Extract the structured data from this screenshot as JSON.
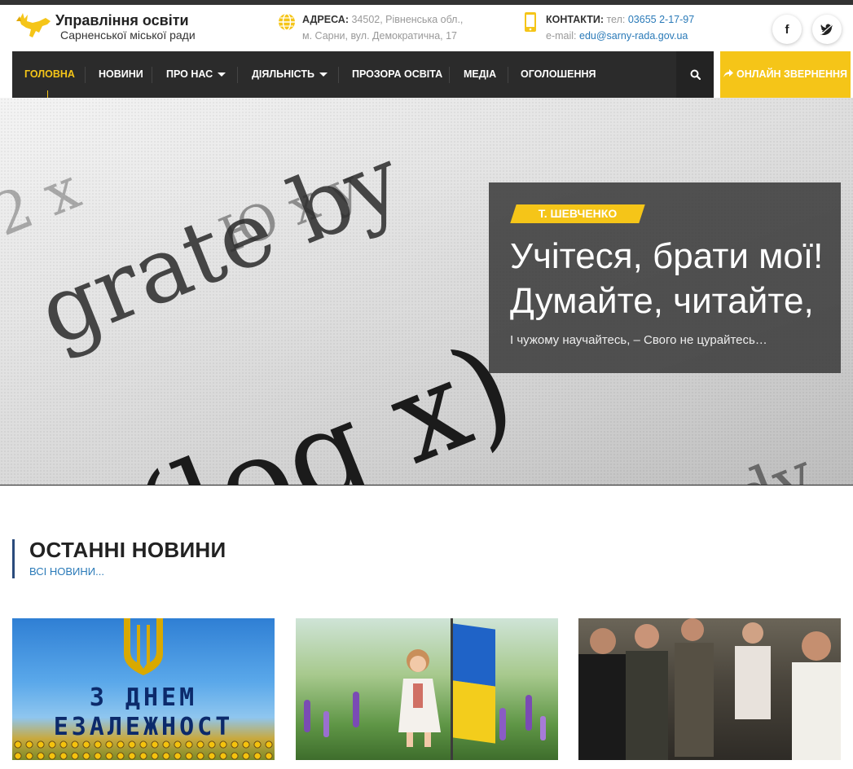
{
  "header": {
    "site_title": "Управління освіти",
    "site_subtitle": "Сарненської міської ради",
    "address_label": "АДРЕСА:",
    "address_line1": "34502, Рівненська обл.,",
    "address_line2": "м. Сарни, вул. Демократична, 17",
    "contacts_label": "КОНТАКТИ:",
    "phone_label": "тел:",
    "phone": "03655 2-17-97",
    "email_label": "e-mail:",
    "email": "edu@sarny-rada.gov.ua",
    "facebook_label": "f"
  },
  "nav": {
    "items": [
      {
        "label": "ГОЛОВНА",
        "active": true
      },
      {
        "label": "НОВИНИ"
      },
      {
        "label": "ПРО НАС",
        "dropdown": true
      },
      {
        "label": "ДІЯЛЬНІСТЬ",
        "dropdown": true
      },
      {
        "label": "ПРОЗОРА ОСВІТА"
      },
      {
        "label": "МЕДІА"
      },
      {
        "label": "ОГОЛОШЕННЯ"
      }
    ],
    "online_button": "ОНЛАЙН ЗВЕРНЕННЯ"
  },
  "hero": {
    "tag": "Т. ШЕВЧЕНКО",
    "quote_line1": "Учітеся, брати мої!",
    "quote_line2": "Думайте, читайте,",
    "quote_sub": "І чужому научайтесь, – Свого не цурайтесь…",
    "bg_words": [
      "grate by",
      "(log x)",
      "Ю x y",
      "e dy",
      "2 x"
    ]
  },
  "news": {
    "title": "ОСТАННІ НОВИНИ",
    "all_link": "ВСІ НОВИНИ...",
    "card1_line1": "З ДНЕМ",
    "card1_line2": "ЕЗАЛЕЖНОСТ"
  },
  "colors": {
    "accent": "#f5c518",
    "nav_bg": "#2b2b2b",
    "link": "#2a7ab8",
    "section_bar": "#2a4b7c"
  },
  "icons": {
    "logo": "deer-logo-icon",
    "address": "globe-icon",
    "contacts": "phone-icon",
    "search": "search-icon",
    "online": "share-arrow-icon",
    "facebook": "facebook-icon",
    "twitter": "twitter-icon"
  }
}
